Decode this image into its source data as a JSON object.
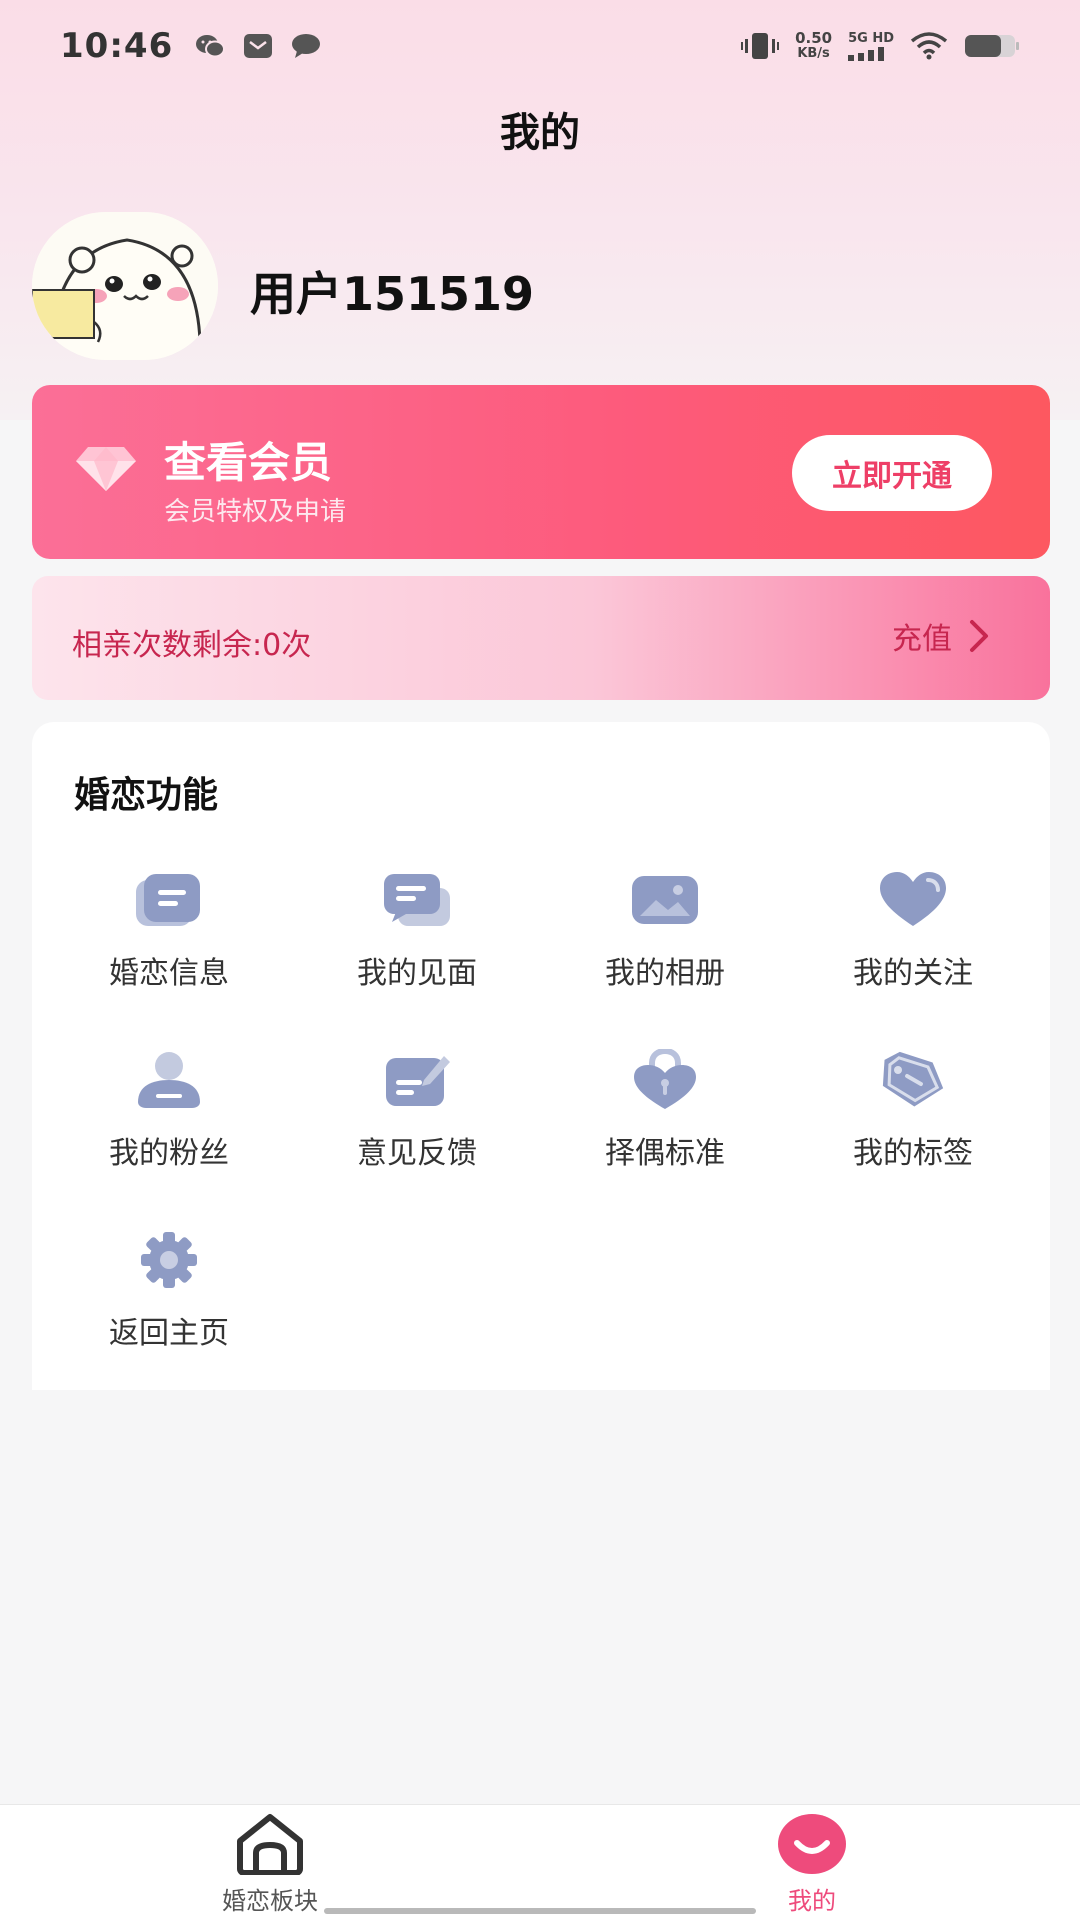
{
  "status_bar": {
    "time": "10:46",
    "net_speed_value": "0.50",
    "net_speed_unit": "KB/s",
    "net_type": "5G HD",
    "icons": [
      "wechat-icon",
      "mail-icon",
      "chat-icon",
      "vibrate-icon",
      "signal-icon",
      "wifi-icon",
      "battery-icon"
    ]
  },
  "header": {
    "title": "我的"
  },
  "profile": {
    "username": "用户151519"
  },
  "member": {
    "title": "查看会员",
    "subtitle": "会员特权及申请",
    "button": "立即开通",
    "accent": "#fd5a7b"
  },
  "recharge": {
    "remaining": "相亲次数剩余:0次",
    "link": "充值"
  },
  "functions": {
    "title": "婚恋功能",
    "items": [
      {
        "label": "婚恋信息",
        "icon": "info-card-icon"
      },
      {
        "label": "我的见面",
        "icon": "chat-bubbles-icon"
      },
      {
        "label": "我的相册",
        "icon": "photo-icon"
      },
      {
        "label": "我的关注",
        "icon": "heart-icon"
      },
      {
        "label": "我的粉丝",
        "icon": "user-icon"
      },
      {
        "label": "意见反馈",
        "icon": "feedback-icon"
      },
      {
        "label": "择偶标准",
        "icon": "heart-lock-icon"
      },
      {
        "label": "我的标签",
        "icon": "tag-icon"
      },
      {
        "label": "返回主页",
        "icon": "gear-icon"
      }
    ],
    "icon_color": "#8e9bc4"
  },
  "bottom_nav": {
    "items": [
      {
        "label": "婚恋板块",
        "icon": "home-icon",
        "active": false
      },
      {
        "label": "我的",
        "icon": "smile-icon",
        "active": true
      }
    ],
    "active_color": "#ee4b7c"
  }
}
